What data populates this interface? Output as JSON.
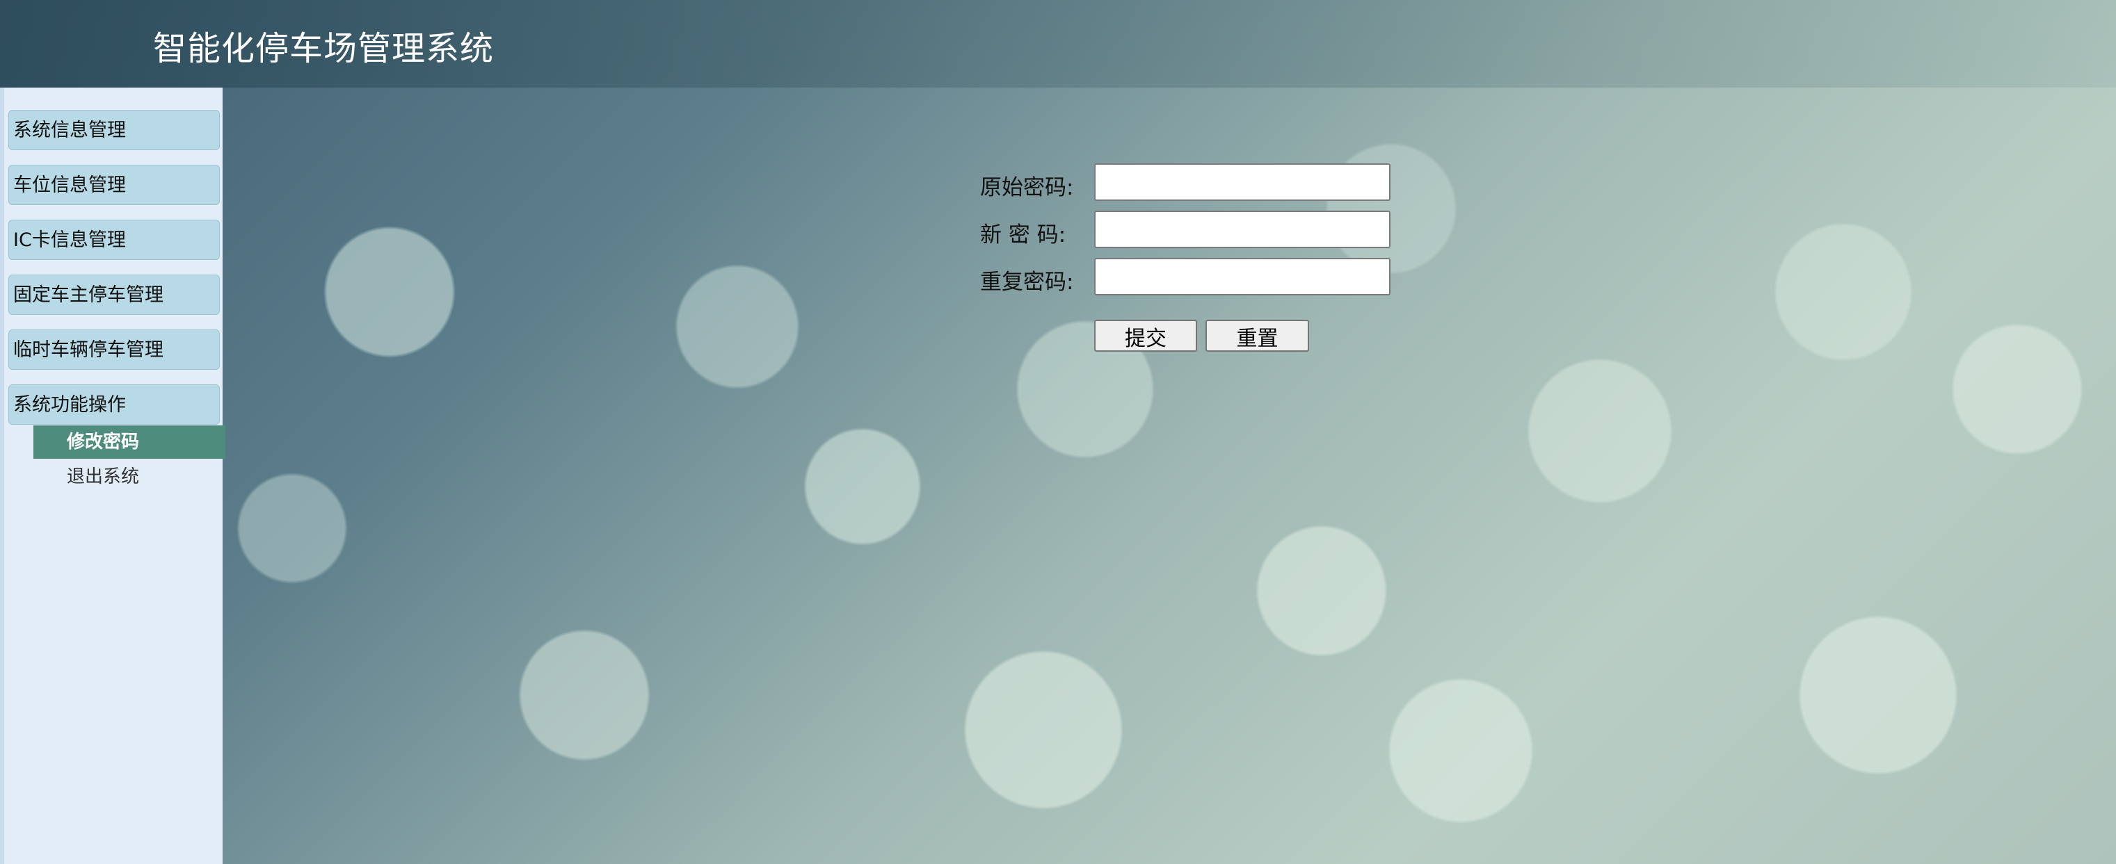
{
  "header": {
    "title": "智能化停车场管理系统"
  },
  "sidebar": {
    "menus": [
      {
        "label": "系统信息管理"
      },
      {
        "label": "车位信息管理"
      },
      {
        "label": "IC卡信息管理"
      },
      {
        "label": "固定车主停车管理"
      },
      {
        "label": "临时车辆停车管理"
      },
      {
        "label": "系统功能操作"
      }
    ],
    "submenu": [
      {
        "label": "修改密码",
        "active": true
      },
      {
        "label": "退出系统",
        "active": false
      }
    ]
  },
  "form": {
    "old_password_label": "原始密码:",
    "old_password_value": "",
    "new_password_label": "新 密 码:",
    "new_password_value": "",
    "repeat_password_label": "重复密码:",
    "repeat_password_value": "",
    "submit_label": "提交",
    "reset_label": "重置"
  },
  "colors": {
    "sidebar_bg": "#e2edf7",
    "menu_bg": "#b7dae6",
    "active_submenu_bg": "#4e8d7d"
  }
}
